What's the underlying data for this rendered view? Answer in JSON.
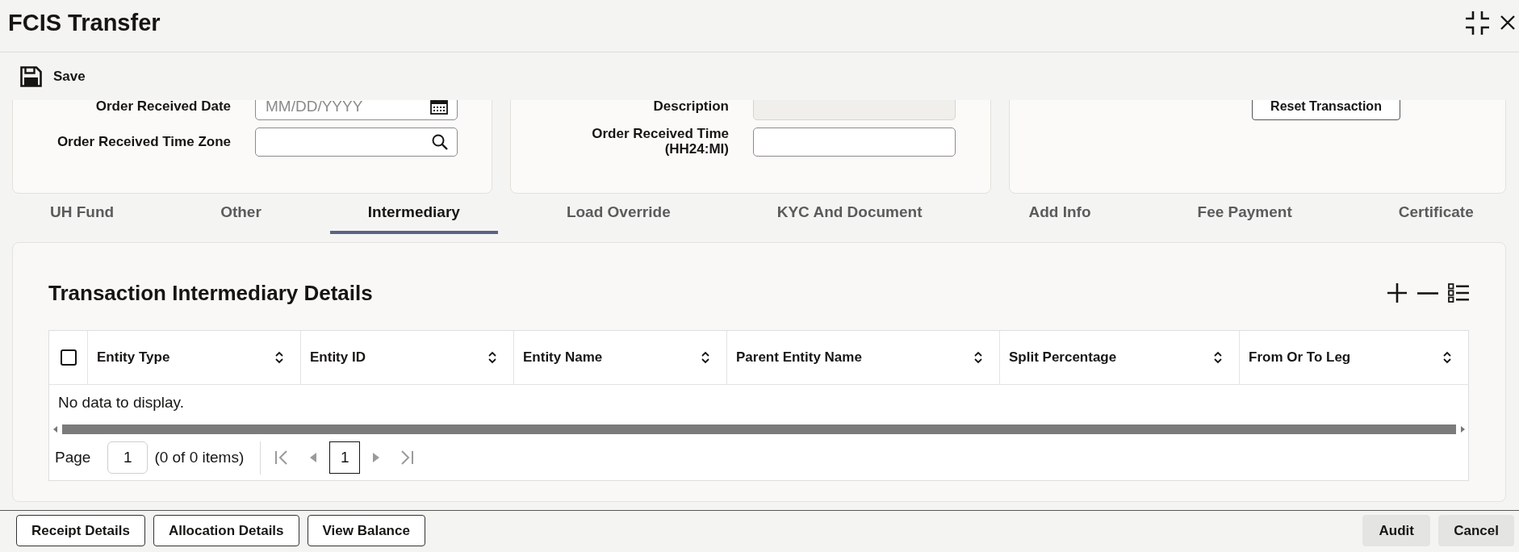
{
  "window": {
    "title": "FCIS Transfer"
  },
  "toolbar": {
    "buttons": [
      {
        "label": "Save"
      }
    ]
  },
  "form_panels": [
    {
      "fields": [
        {
          "label": "Order Received Date",
          "kind": "date",
          "placeholder": "MM/DD/YYYY",
          "disabled": false
        },
        {
          "label": "Order Received Time Zone",
          "kind": "lookup",
          "disabled": false
        }
      ]
    },
    {
      "fields": [
        {
          "label": "Description",
          "kind": "text",
          "disabled": true
        },
        {
          "label": "Order Received Time (HH24:MI)",
          "kind": "text",
          "disabled": false
        }
      ]
    },
    {
      "buttons": [
        {
          "label": "Reset Transaction"
        }
      ]
    }
  ],
  "tabs": [
    {
      "label": "UH Fund",
      "selected": false
    },
    {
      "label": "Other",
      "selected": false
    },
    {
      "label": "Intermediary",
      "selected": true
    },
    {
      "label": "Load Override",
      "selected": false
    },
    {
      "label": "KYC And Document",
      "selected": false
    },
    {
      "label": "Add Info",
      "selected": false
    },
    {
      "label": "Fee Payment",
      "selected": false
    },
    {
      "label": "Certificate",
      "selected": false
    }
  ],
  "section": {
    "title": "Transaction Intermediary Details",
    "table": {
      "select_all": {
        "checked": false
      },
      "columns": [
        "Entity Type",
        "Entity ID",
        "Entity Name",
        "Parent Entity Name",
        "Split Percentage",
        "From Or To Leg"
      ],
      "empty_message": "No data to display."
    },
    "pagination": {
      "page_label": "Page",
      "page_value": "1",
      "summary": "(0 of 0 items)",
      "nav_buttons": [
        {
          "kind": "first",
          "disabled": true
        },
        {
          "kind": "previous",
          "disabled": true
        },
        {
          "kind": "next",
          "disabled": true
        },
        {
          "kind": "last",
          "disabled": true
        }
      ],
      "pages": [
        {
          "label": "1",
          "selected": true
        }
      ]
    }
  },
  "footer": {
    "left_buttons": [
      {
        "label": "Receipt Details"
      },
      {
        "label": "Allocation Details"
      },
      {
        "label": "View Balance"
      }
    ],
    "right_buttons": [
      {
        "label": "Audit"
      },
      {
        "label": "Cancel"
      }
    ]
  }
}
